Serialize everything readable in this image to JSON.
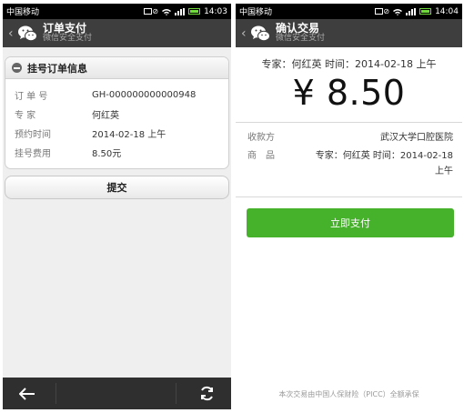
{
  "left": {
    "status": {
      "carrier": "中国移动",
      "time": "14:03"
    },
    "titlebar": {
      "title": "订单支付",
      "subtitle": "微信安全支付"
    },
    "card": {
      "title": "挂号订单信息",
      "rows": [
        {
          "label": "订 单 号",
          "value": "GH-000000000000948"
        },
        {
          "label": "专 家",
          "value": "何红英"
        },
        {
          "label": "预约时间",
          "value": "2014-02-18 上午"
        },
        {
          "label": "挂号费用",
          "value": "8.50元"
        }
      ]
    },
    "submit_label": "提交"
  },
  "right": {
    "status": {
      "carrier": "中国移动",
      "time": "14:04"
    },
    "titlebar": {
      "title": "确认交易",
      "subtitle": "微信安全支付"
    },
    "merchant_desc": "专家：何红英 时间：2014-02-18 上午",
    "amount": "¥ 8.50",
    "details": {
      "payee_label": "收款方",
      "payee_value": "武汉大学口腔医院",
      "goods_label": "商　品",
      "goods_value_line1": "专家：何红英 时间：2014-02-18",
      "goods_value_line2": "上午"
    },
    "pay_label": "立即支付",
    "footer_note": "本次交易由中国人保财险（PICC）全额承保"
  },
  "colors": {
    "pay_green": "#46b22b",
    "titlebar": "#3e3e3e",
    "battery": "#6fdc3b"
  },
  "icons": [
    "wechat-icon",
    "back-arrow-icon",
    "refresh-icon",
    "wifi-icon",
    "signal-icon",
    "battery-icon",
    "minus-icon"
  ]
}
